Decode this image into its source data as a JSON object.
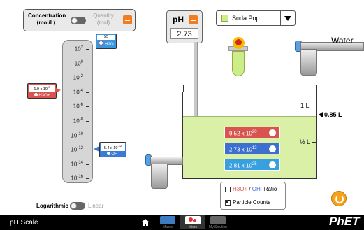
{
  "toggle_panel": {
    "left_label_line1": "Concentration",
    "left_label_line2": "(mol/L)",
    "right_label_line1": "Quantity",
    "right_label_line2": "(mol)"
  },
  "scale": {
    "ticks": [
      "10",
      "10",
      "10",
      "10",
      "10",
      "10",
      "10",
      "10",
      "10"
    ],
    "exponents": [
      "2",
      "0",
      "-2",
      "-4",
      "-6",
      "-8",
      "-10",
      "-12",
      "-14",
      "-16"
    ],
    "h2o_value": "55",
    "h2o_label": "H2O",
    "h3o_value": "1.9 x 10",
    "h3o_exp": "-3",
    "h3o_label": "H3O+",
    "oh_value": "5.4 x 10",
    "oh_exp": "-12",
    "oh_label": "OH-",
    "mode_left": "Logarithmic",
    "mode_right": "Linear"
  },
  "ph_meter": {
    "title": "pH",
    "value": "2.73"
  },
  "solute": {
    "selected": "Soda Pop",
    "color": "#ccee88"
  },
  "beaker": {
    "water_label": "Water",
    "mark_1L": "1 L",
    "mark_half": "½ L",
    "volume": "0.85 L",
    "counts": {
      "h3o_mantissa": "9.52 x 10",
      "h3o_exp": "20",
      "oh_mantissa": "2.73 x 10",
      "oh_exp": "12",
      "h2o_mantissa": "2.81 x 10",
      "h2o_exp": "25"
    }
  },
  "options": {
    "ratio_label_h3o": "H3O+",
    "ratio_label_sep": " / ",
    "ratio_label_oh": "OH-",
    "ratio_label_suffix": " Ratio",
    "ratio_checked": false,
    "particle_counts_label": "Particle Counts",
    "particle_counts_checked": true
  },
  "navbar": {
    "title": "pH Scale",
    "screens": [
      "Macro",
      "Micro",
      "My Solution"
    ],
    "logo": "PhET"
  },
  "colors": {
    "h3o": "#d9534f",
    "oh": "#3d6fd1",
    "h2o": "#39a0e0",
    "accent": "#f07d22"
  }
}
